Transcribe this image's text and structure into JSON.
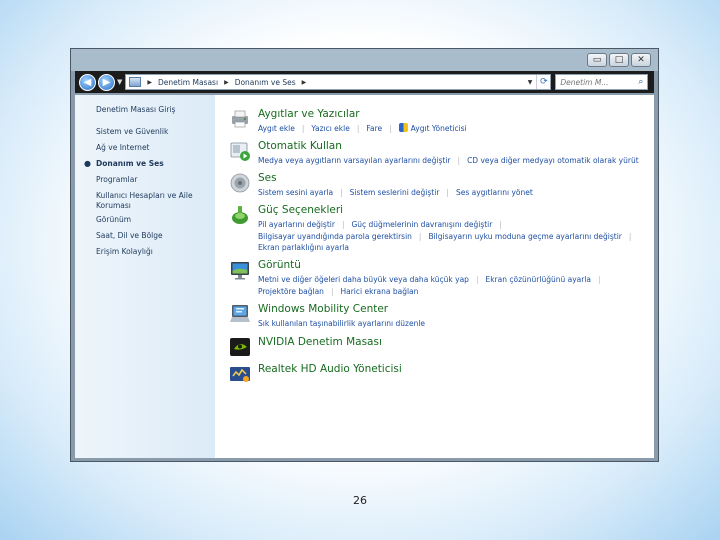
{
  "window": {
    "controls": {
      "minimize": "▭",
      "maximize": "□",
      "close": "✕"
    }
  },
  "addressbar": {
    "breadcrumbs": [
      "Denetim Masası",
      "Donanım ve Ses"
    ],
    "search_placeholder": "Denetim M..."
  },
  "sidebar": {
    "items": [
      {
        "label": "Denetim Masası Giriş"
      },
      {
        "label": "Sistem ve Güvenlik"
      },
      {
        "label": "Ağ ve Internet"
      },
      {
        "label": "Donanım ve Ses",
        "active": true
      },
      {
        "label": "Programlar"
      },
      {
        "label": "Kullanıcı Hesapları ve Aile Koruması"
      },
      {
        "label": "Görünüm"
      },
      {
        "label": "Saat, Dil ve Bölge"
      },
      {
        "label": "Erişim Kolaylığı"
      }
    ]
  },
  "categories": [
    {
      "title": "Aygıtlar ve Yazıcılar",
      "icon": "printer-icon",
      "links": [
        "Aygıt ekle",
        "Yazıcı ekle",
        "Fare",
        "Aygıt Yöneticisi"
      ]
    },
    {
      "title": "Otomatik Kullan",
      "icon": "autoplay-icon",
      "links": [
        "Medya veya aygıtların varsayılan ayarlarını değiştir",
        "CD veya diğer medyayı otomatik olarak yürüt"
      ]
    },
    {
      "title": "Ses",
      "icon": "speaker-icon",
      "links": [
        "Sistem sesini ayarla",
        "Sistem seslerini değiştir",
        "Ses aygıtlarını yönet"
      ]
    },
    {
      "title": "Güç Seçenekleri",
      "icon": "power-options-icon",
      "links": [
        "Pil ayarlarını değiştir",
        "Güç düğmelerinin davranışını değiştir",
        "Bilgisayar uyandığında parola gerektirsin",
        "Bilgisayarın uyku moduna geçme ayarlarını değiştir",
        "Ekran parlaklığını ayarla"
      ]
    },
    {
      "title": "Görüntü",
      "icon": "display-icon",
      "links": [
        "Metni ve diğer öğeleri daha büyük veya daha küçük yap",
        "Ekran çözünürlüğünü ayarla",
        "Projektöre bağlan",
        "Harici ekrana bağlan"
      ]
    },
    {
      "title": "Windows Mobility Center",
      "icon": "mobility-center-icon",
      "links": [
        "Sık kullanılan taşınabilirlik ayarlarını düzenle"
      ]
    },
    {
      "title": "NVIDIA Denetim Masası",
      "icon": "nvidia-icon",
      "links": []
    },
    {
      "title": "Realtek HD Audio Yöneticisi",
      "icon": "realtek-audio-icon",
      "links": []
    }
  ],
  "page_number": "26"
}
